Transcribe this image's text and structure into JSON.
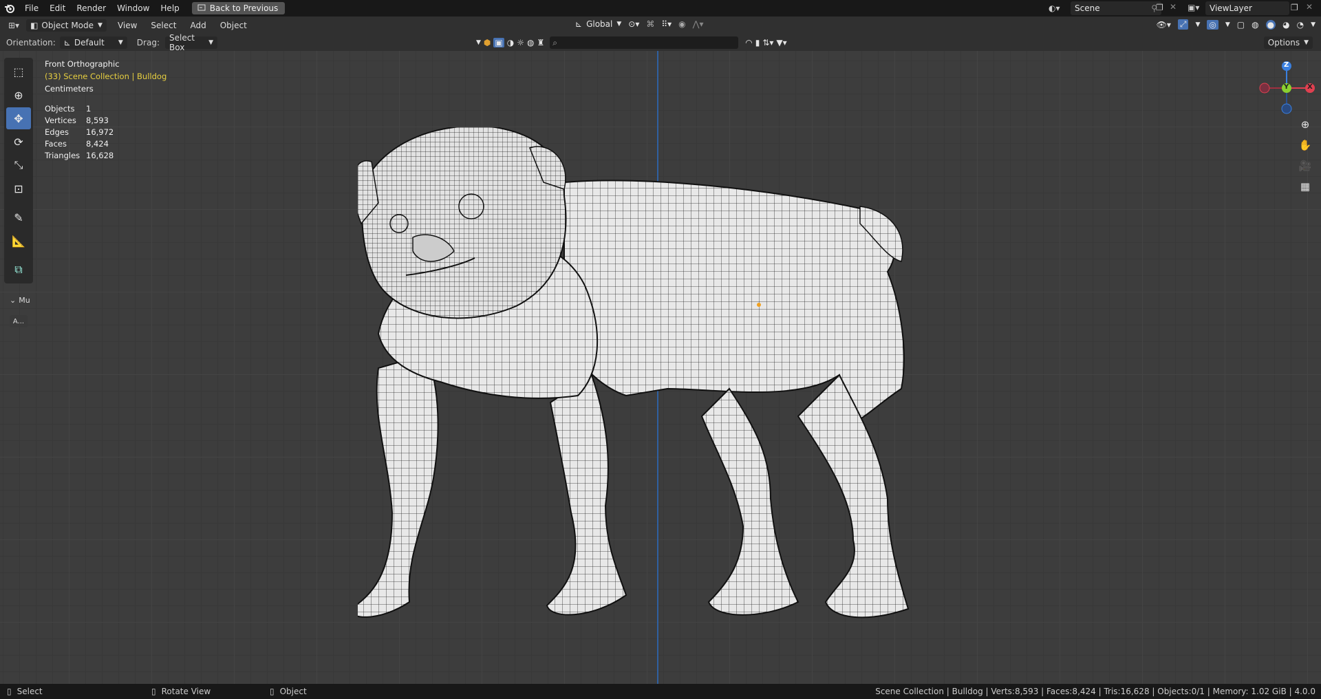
{
  "topbar": {
    "menu": [
      "File",
      "Edit",
      "Render",
      "Window",
      "Help"
    ],
    "back_button": "Back to Previous",
    "scene": "Scene",
    "view_layer": "ViewLayer"
  },
  "header": {
    "mode": "Object Mode",
    "menus": [
      "View",
      "Select",
      "Add",
      "Object"
    ],
    "transform_orientation": "Global",
    "options": "Options"
  },
  "tool_settings": {
    "orientation_label": "Orientation:",
    "orientation_value": "Default",
    "drag_label": "Drag:",
    "drag_value": "Select Box"
  },
  "viewport": {
    "view_name": "Front Orthographic",
    "collection": "(33) Scene Collection | Bulldog",
    "units": "Centimeters",
    "stats": [
      {
        "label": "Objects",
        "value": "1"
      },
      {
        "label": "Vertices",
        "value": "8,593"
      },
      {
        "label": "Edges",
        "value": "16,972"
      },
      {
        "label": "Faces",
        "value": "8,424"
      },
      {
        "label": "Triangles",
        "value": "16,628"
      }
    ],
    "gizmo": {
      "x": "X",
      "y": "Y",
      "z": "Z"
    },
    "panel_collapse": "Mu",
    "panel_button": "A..."
  },
  "statusbar": {
    "left": [
      {
        "label": "Select"
      },
      {
        "label": "Rotate View"
      },
      {
        "label": "Object"
      }
    ],
    "right": "Scene Collection | Bulldog | Verts:8,593 | Faces:8,424 | Tris:16,628 | Objects:0/1 | Memory: 1.02 GiB | 4.0.0"
  },
  "colors": {
    "accent": "#4772b3",
    "x_axis": "#e04050",
    "y_axis": "#8ad030",
    "z_axis": "#3a80e0",
    "collection_text": "#e8d040"
  }
}
